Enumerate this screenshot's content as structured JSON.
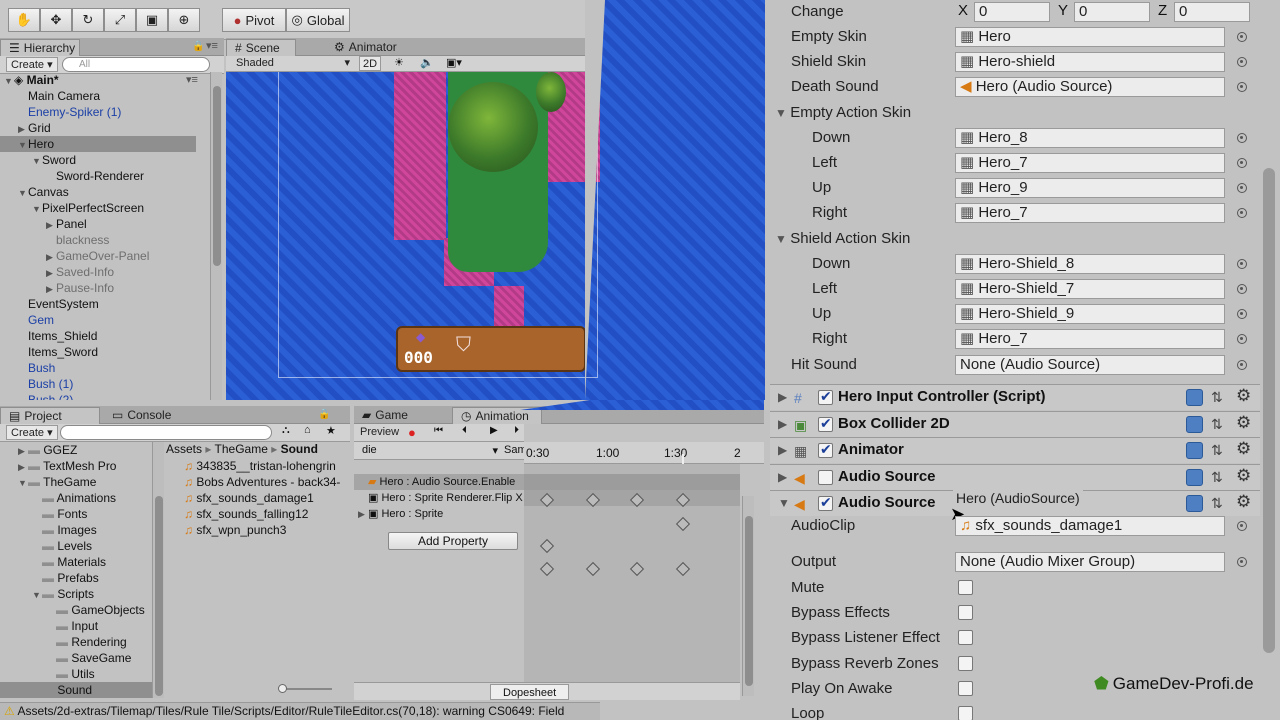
{
  "toolbar": {
    "tools": [
      "hand-tool-icon",
      "move-tool-icon",
      "rotate-tool-icon",
      "scale-tool-icon",
      "rect-tool-icon",
      "transform-tool-icon"
    ],
    "pivot": "Pivot",
    "global": "Global"
  },
  "hierarchy": {
    "tab": "Hierarchy",
    "create": "Create",
    "search_placeholder": "All",
    "scene": "Main*",
    "items": [
      {
        "label": "Main Camera",
        "indent": 1,
        "style": "normal",
        "arrow": ""
      },
      {
        "label": "Enemy-Spiker (1)",
        "indent": 1,
        "style": "blue",
        "arrow": ""
      },
      {
        "label": "Grid",
        "indent": 1,
        "style": "normal",
        "arrow": "▶"
      },
      {
        "label": "Hero",
        "indent": 1,
        "style": "normal",
        "arrow": "▼",
        "selected": true
      },
      {
        "label": "Sword",
        "indent": 2,
        "style": "normal",
        "arrow": "▼"
      },
      {
        "label": "Sword-Renderer",
        "indent": 3,
        "style": "normal",
        "arrow": ""
      },
      {
        "label": "Canvas",
        "indent": 1,
        "style": "normal",
        "arrow": "▼"
      },
      {
        "label": "PixelPerfectScreen",
        "indent": 2,
        "style": "normal",
        "arrow": "▼"
      },
      {
        "label": "Panel",
        "indent": 3,
        "style": "normal",
        "arrow": "▶"
      },
      {
        "label": "blackness",
        "indent": 3,
        "style": "gray",
        "arrow": ""
      },
      {
        "label": "GameOver-Panel",
        "indent": 3,
        "style": "gray",
        "arrow": "▶"
      },
      {
        "label": "Saved-Info",
        "indent": 3,
        "style": "gray",
        "arrow": "▶"
      },
      {
        "label": "Pause-Info",
        "indent": 3,
        "style": "gray",
        "arrow": "▶"
      },
      {
        "label": "EventSystem",
        "indent": 1,
        "style": "normal",
        "arrow": ""
      },
      {
        "label": "Gem",
        "indent": 1,
        "style": "blue",
        "arrow": ""
      },
      {
        "label": "Items_Shield",
        "indent": 1,
        "style": "normal",
        "arrow": ""
      },
      {
        "label": "Items_Sword",
        "indent": 1,
        "style": "normal",
        "arrow": ""
      },
      {
        "label": "Bush",
        "indent": 1,
        "style": "blue",
        "arrow": ""
      },
      {
        "label": "Bush (1)",
        "indent": 1,
        "style": "blue",
        "arrow": ""
      },
      {
        "label": "Bush (2)",
        "indent": 1,
        "style": "blue",
        "arrow": ""
      }
    ]
  },
  "scene_view": {
    "tab_scene": "Scene",
    "tab_animator": "Animator",
    "shading": "Shaded",
    "mode_2d": "2D",
    "hud_value": "000"
  },
  "project": {
    "tab_project": "Project",
    "tab_console": "Console",
    "create": "Create",
    "folders": [
      {
        "label": "GGEZ",
        "indent": 1,
        "arrow": "▶"
      },
      {
        "label": "TextMesh Pro",
        "indent": 1,
        "arrow": "▶"
      },
      {
        "label": "TheGame",
        "indent": 1,
        "arrow": "▼"
      },
      {
        "label": "Animations",
        "indent": 2,
        "arrow": ""
      },
      {
        "label": "Fonts",
        "indent": 2,
        "arrow": ""
      },
      {
        "label": "Images",
        "indent": 2,
        "arrow": ""
      },
      {
        "label": "Levels",
        "indent": 2,
        "arrow": ""
      },
      {
        "label": "Materials",
        "indent": 2,
        "arrow": ""
      },
      {
        "label": "Prefabs",
        "indent": 2,
        "arrow": ""
      },
      {
        "label": "Scripts",
        "indent": 2,
        "arrow": "▼"
      },
      {
        "label": "GameObjects",
        "indent": 3,
        "arrow": ""
      },
      {
        "label": "Input",
        "indent": 3,
        "arrow": ""
      },
      {
        "label": "Rendering",
        "indent": 3,
        "arrow": ""
      },
      {
        "label": "SaveGame",
        "indent": 3,
        "arrow": ""
      },
      {
        "label": "Utils",
        "indent": 3,
        "arrow": ""
      },
      {
        "label": "Sound",
        "indent": 2,
        "arrow": "",
        "selected": true
      }
    ],
    "breadcrumb": [
      "Assets",
      "TheGame",
      "Sound"
    ],
    "files": [
      "343835__tristan-lohengrin",
      "Bobs Adventures - back34-",
      "sfx_sounds_damage1",
      "sfx_sounds_falling12",
      "sfx_wpn_punch3"
    ]
  },
  "animation": {
    "tab_game": "Game",
    "tab_animation": "Animation",
    "preview": "Preview",
    "clip": "die",
    "samples": "Sam",
    "ruler": [
      "0:30",
      "1:00",
      "1:30",
      "2"
    ],
    "tracks": [
      "Hero : Audio Source.Enable",
      "Hero : Sprite Renderer.Flip X",
      "Hero : Sprite"
    ],
    "add_property": "Add Property",
    "dopesheet": "Dopesheet"
  },
  "inspector": {
    "change_label": "Change",
    "change_x": "0",
    "change_y": "0",
    "change_z": "0",
    "rows": [
      {
        "label": "Empty Skin",
        "value": "Hero",
        "indent": 0,
        "icon": "sprite-icon"
      },
      {
        "label": "Shield Skin",
        "value": "Hero-shield",
        "indent": 0,
        "icon": "sprite-icon"
      },
      {
        "label": "Death Sound",
        "value": "Hero (Audio Source)",
        "indent": 0,
        "icon": "audio-source-icon"
      },
      {
        "label": "Empty Action Skin",
        "value": "",
        "indent": 0,
        "header": true
      },
      {
        "label": "Down",
        "value": "Hero_8",
        "indent": 1,
        "icon": "sprite-icon"
      },
      {
        "label": "Left",
        "value": "Hero_7",
        "indent": 1,
        "icon": "sprite-icon"
      },
      {
        "label": "Up",
        "value": "Hero_9",
        "indent": 1,
        "icon": "sprite-icon"
      },
      {
        "label": "Right",
        "value": "Hero_7",
        "indent": 1,
        "icon": "sprite-icon"
      },
      {
        "label": "Shield Action Skin",
        "value": "",
        "indent": 0,
        "header": true
      },
      {
        "label": "Down",
        "value": "Hero-Shield_8",
        "indent": 1,
        "icon": "sprite-icon"
      },
      {
        "label": "Left",
        "value": "Hero-Shield_7",
        "indent": 1,
        "icon": "sprite-icon"
      },
      {
        "label": "Up",
        "value": "Hero-Shield_9",
        "indent": 1,
        "icon": "sprite-icon"
      },
      {
        "label": "Right",
        "value": "Hero_7",
        "indent": 1,
        "icon": "sprite-icon"
      },
      {
        "label": "Hit Sound",
        "value": "None (Audio Source)",
        "indent": 0,
        "icon": ""
      }
    ],
    "components": [
      {
        "name": "Hero Input Controller (Script)",
        "enabled": true,
        "icon": "script-icon"
      },
      {
        "name": "Box Collider 2D",
        "enabled": true,
        "icon": "box-collider-icon"
      },
      {
        "name": "Animator",
        "enabled": true,
        "icon": "animator-icon"
      },
      {
        "name": "Audio Source",
        "enabled": false,
        "icon": "audio-source-icon"
      },
      {
        "name": "Audio Source",
        "enabled": true,
        "icon": "audio-source-icon",
        "expanded": true
      }
    ],
    "tooltip": "Hero (AudioSource)",
    "audio_clip_label": "AudioClip",
    "audio_clip_value": "sfx_sounds_damage1",
    "output_label": "Output",
    "output_value": "None (Audio Mixer Group)",
    "toggles": [
      "Mute",
      "Bypass Effects",
      "Bypass Listener Effect",
      "Bypass Reverb Zones",
      "Play On Awake",
      "Loop"
    ]
  },
  "watermark": "GameDev-Profi.de",
  "status_bar": "Assets/2d-extras/Tilemap/Tiles/Rule Tile/Scripts/Editor/RuleTileEditor.cs(70,18): warning CS0649: Field"
}
